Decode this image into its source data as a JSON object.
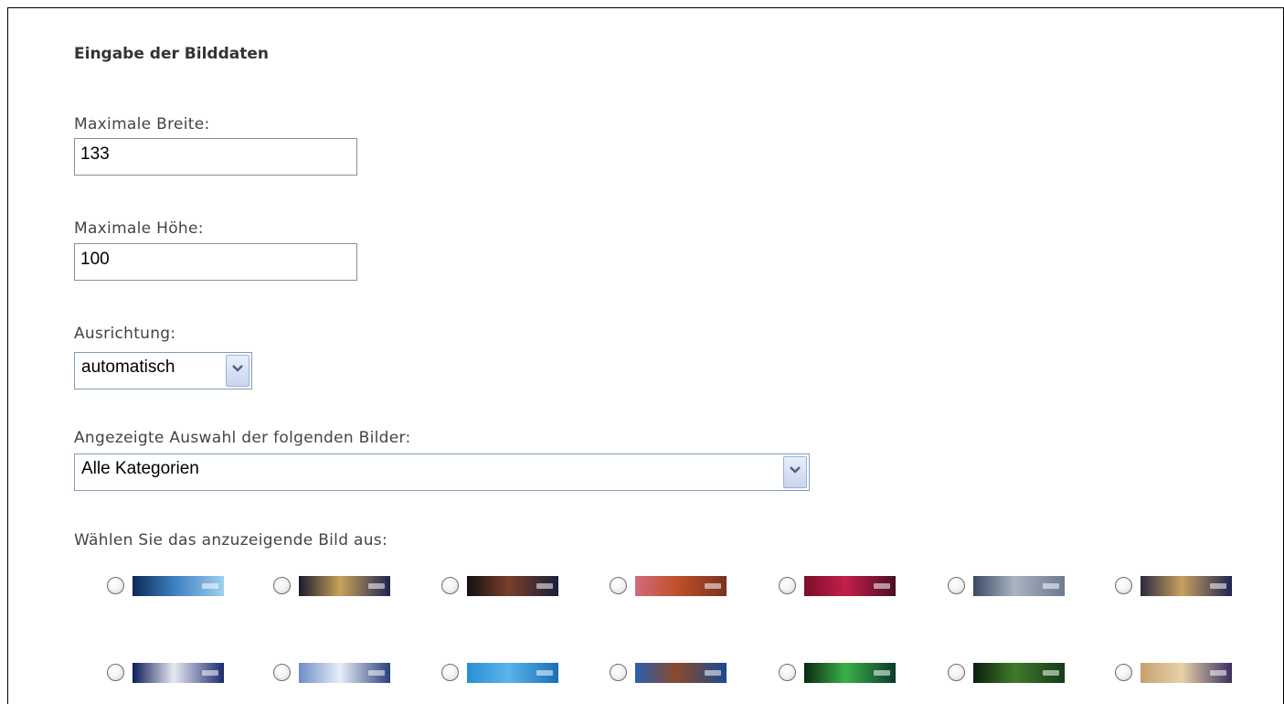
{
  "form": {
    "heading": "Eingabe der Bilddaten",
    "max_width": {
      "label": "Maximale Breite:",
      "value": "133"
    },
    "max_height": {
      "label": "Maximale Höhe:",
      "value": "100"
    },
    "orientation": {
      "label": "Ausrichtung:",
      "selected": "automatisch"
    },
    "selection": {
      "label": "Angezeigte Auswahl der folgenden Bilder:",
      "selected": "Alle Kategorien"
    },
    "image_choice": {
      "label": "Wählen Sie das anzuzeigende Bild aus:"
    }
  },
  "images": [
    {
      "theme": "ice-blue",
      "colors": [
        "#0b2a55",
        "#3b7fc0",
        "#9ed0ee"
      ],
      "selected": false
    },
    {
      "theme": "desert-gold",
      "colors": [
        "#1a1a2e",
        "#c9a25a",
        "#1c2550"
      ],
      "selected": false
    },
    {
      "theme": "portrait-dark",
      "colors": [
        "#111111",
        "#7a3e2a",
        "#1b1f3a"
      ],
      "selected": false
    },
    {
      "theme": "sunset-canyon",
      "colors": [
        "#d36a7c",
        "#c0502a",
        "#7a3120"
      ],
      "selected": false
    },
    {
      "theme": "red-field",
      "colors": [
        "#7a0f2a",
        "#c41e4a",
        "#4a1025"
      ],
      "selected": false
    },
    {
      "theme": "grey-rocks",
      "colors": [
        "#3a4a66",
        "#aab4c0",
        "#6b7a90"
      ],
      "selected": false
    },
    {
      "theme": "village-sunset",
      "colors": [
        "#2a2a40",
        "#c8a060",
        "#1c2550"
      ],
      "selected": false
    },
    {
      "theme": "symbols-blue",
      "colors": [
        "#0a1c5a",
        "#e8e8f0",
        "#1a2a70"
      ],
      "selected": false
    },
    {
      "theme": "sky-feathers",
      "colors": [
        "#6c8ec6",
        "#e7eef8",
        "#2a3f7a"
      ],
      "selected": false
    },
    {
      "theme": "eagle-sky",
      "colors": [
        "#2a8fd6",
        "#5ab4ea",
        "#1a6fb6"
      ],
      "selected": false
    },
    {
      "theme": "monument-valley",
      "colors": [
        "#2a5fb0",
        "#8a4a2a",
        "#1a4a90"
      ],
      "selected": false
    },
    {
      "theme": "green-leaf",
      "colors": [
        "#0a2a10",
        "#3ab04a",
        "#0a3a2a"
      ],
      "selected": false
    },
    {
      "theme": "green-forest",
      "colors": [
        "#0b1f0e",
        "#3f7a2a",
        "#173a1a"
      ],
      "selected": false
    },
    {
      "theme": "sand-ruins",
      "colors": [
        "#c8a070",
        "#e8d0a8",
        "#3a3060"
      ],
      "selected": false
    }
  ]
}
